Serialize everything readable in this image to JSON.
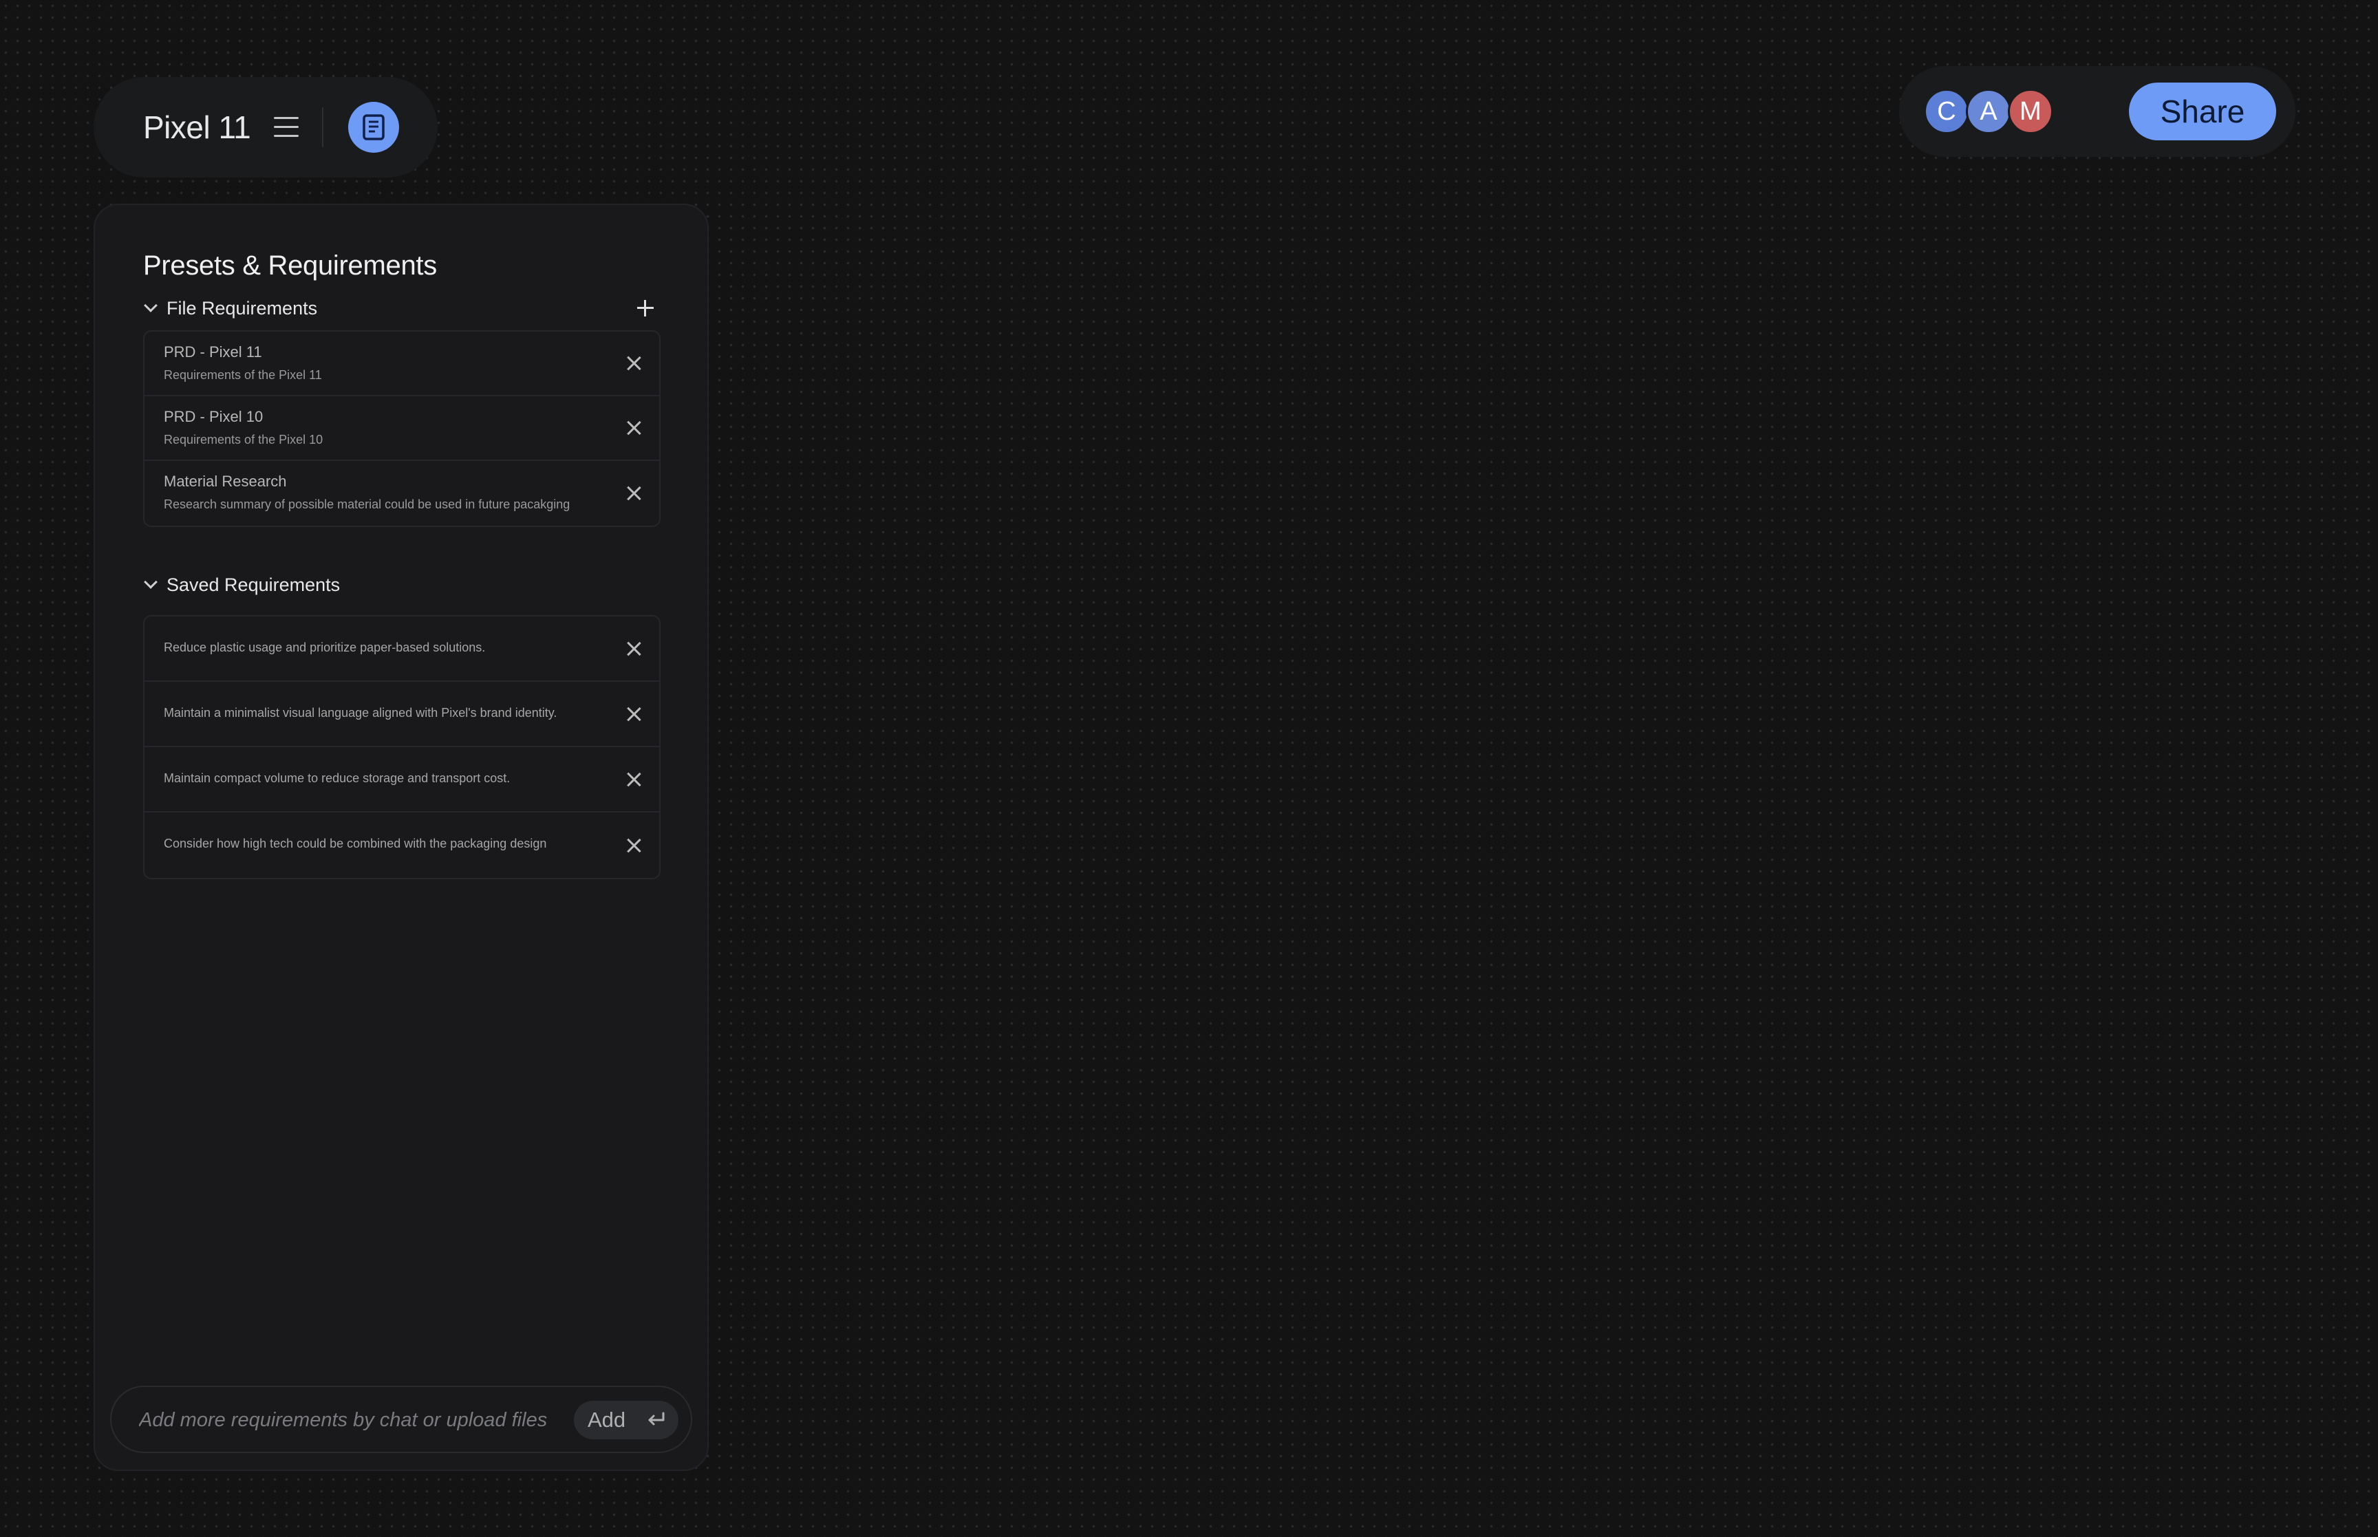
{
  "header": {
    "title": "Pixel 11",
    "menu_icon": "hamburger-menu-icon",
    "doc_icon": "document-icon",
    "accent_color": "#6d9bf5"
  },
  "collaborators": {
    "avatars": [
      {
        "initial": "C",
        "color": "#5b7fd6"
      },
      {
        "initial": "A",
        "color": "#6a88d8"
      },
      {
        "initial": "M",
        "color": "#c95a5a"
      }
    ],
    "share_label": "Share"
  },
  "panel": {
    "title": "Presets &  Requirements",
    "file_requirements": {
      "label": "File Requirements",
      "items": [
        {
          "title": "PRD - Pixel 11",
          "subtitle": "Requirements of the Pixel 11"
        },
        {
          "title": "PRD - Pixel 10",
          "subtitle": "Requirements of the Pixel 10"
        },
        {
          "title": "Material Research",
          "subtitle": "Research summary of possible material could be used in future pacakging"
        }
      ]
    },
    "saved_requirements": {
      "label": "Saved Requirements",
      "items": [
        {
          "text": "Reduce plastic usage and prioritize paper-based solutions."
        },
        {
          "text": "Maintain a minimalist visual language aligned with Pixel's brand identity."
        },
        {
          "text": "Maintain compact volume to reduce storage and transport cost."
        },
        {
          "text": "Consider how high tech could be combined with the packaging design"
        }
      ]
    },
    "chat": {
      "placeholder": "Add more requirements by chat or upload files",
      "add_label": "Add"
    }
  }
}
